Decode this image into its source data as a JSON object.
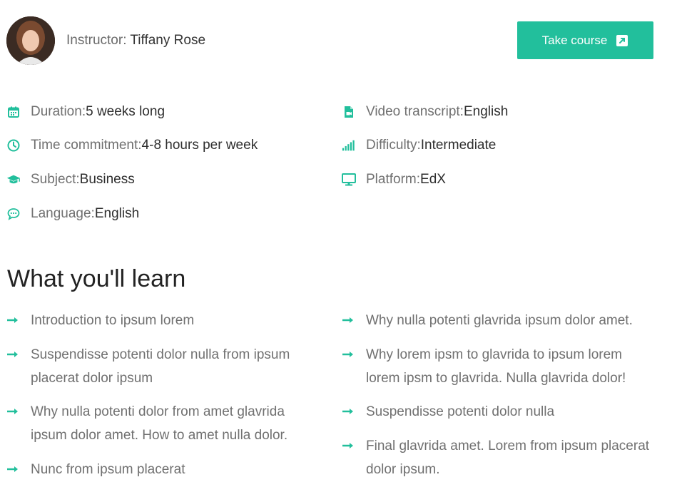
{
  "instructor": {
    "label": "Instructor: ",
    "name": "Tiffany Rose"
  },
  "take_course": {
    "label": "Take course",
    "icon": "external-link-icon"
  },
  "accent_color": "#22bf9c",
  "details": {
    "duration": {
      "label": "Duration: ",
      "value": "5 weeks long",
      "icon": "calendar-icon"
    },
    "time_commitment": {
      "label": "Time commitment: ",
      "value": "4-8 hours per week",
      "icon": "clock-icon"
    },
    "subject": {
      "label": "Subject: ",
      "value": "Business",
      "icon": "graduation-cap-icon"
    },
    "language": {
      "label": "Language: ",
      "value": "English",
      "icon": "chat-bubble-icon"
    },
    "video_transcript": {
      "label": "Video transcript: ",
      "value": "English",
      "icon": "video-file-icon"
    },
    "difficulty": {
      "label": "Difficulty: ",
      "value": "Intermediate",
      "icon": "signal-bars-icon"
    },
    "platform": {
      "label": "Platform: ",
      "value": "EdX",
      "icon": "monitor-icon"
    }
  },
  "learn": {
    "title": "What you'll learn",
    "items": [
      "Introduction to ipsum lorem",
      "Suspendisse potenti dolor nulla from ipsum placerat dolor ipsum",
      "Why nulla potenti dolor from amet glavrida ipsum dolor amet. How to amet nulla dolor.",
      "Nunc from ipsum placerat",
      "Why nulla potenti glavrida ipsum dolor amet.",
      "Why lorem ipsm to glavrida to ipsum lorem lorem ipsm to glavrida. Nulla glavrida dolor!",
      "Suspendisse potenti dolor nulla",
      "Final glavrida amet. Lorem from ipsum placerat dolor ipsum."
    ]
  }
}
